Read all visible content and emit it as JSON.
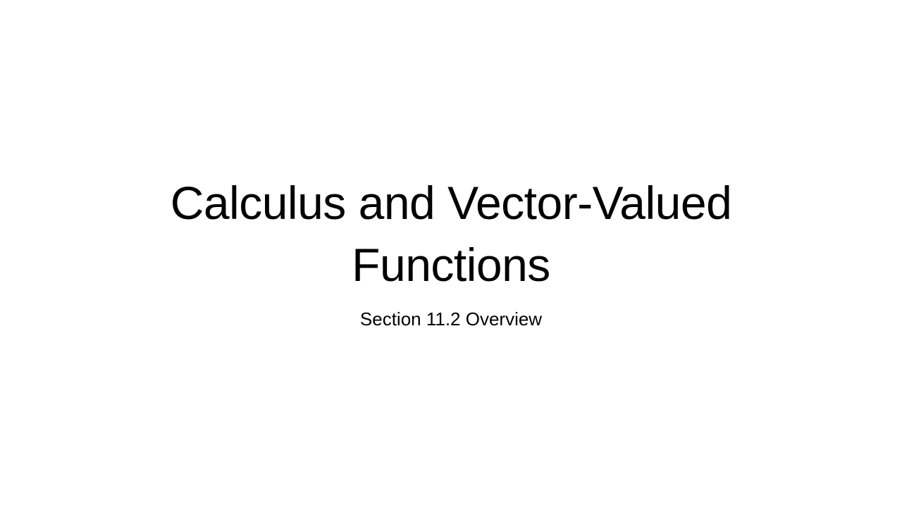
{
  "slide": {
    "title": "Calculus and Vector-Valued Functions",
    "subtitle": "Section 11.2 Overview"
  },
  "colors": {
    "background": "#ffffff",
    "text": "#000000"
  }
}
